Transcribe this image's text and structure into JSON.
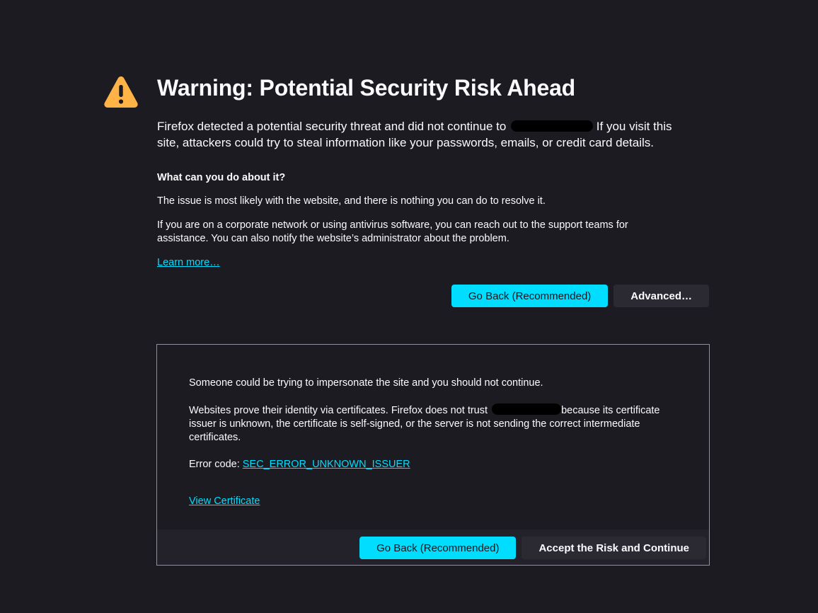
{
  "warning": {
    "icon": "warning-triangle-icon",
    "icon_color": "#ffb347",
    "title": "Warning: Potential Security Risk Ahead",
    "intro_before": "Firefox detected a potential security threat and did not continue to",
    "intro_after": "If you visit this site, attackers could try to steal information like your passwords, emails, or credit card details."
  },
  "help": {
    "heading": "What can you do about it?",
    "para1": "The issue is most likely with the website, and there is nothing you can do to resolve it.",
    "para2": "If you are on a corporate network or using antivirus software, you can reach out to the support teams for assistance. You can also notify the website’s administrator about the problem.",
    "learn_more": "Learn more…"
  },
  "actions": {
    "go_back": "Go Back (Recommended)",
    "advanced": "Advanced…"
  },
  "advanced_panel": {
    "para1": "Someone could be trying to impersonate the site and you should not continue.",
    "para2_before": "Websites prove their identity via certificates. Firefox does not trust",
    "para2_after": "because its certificate issuer is unknown, the certificate is self-signed, or the server is not sending the correct intermediate certificates.",
    "error_label": "Error code:",
    "error_code": "SEC_ERROR_UNKNOWN_ISSUER",
    "view_certificate": "View Certificate",
    "go_back": "Go Back (Recommended)",
    "accept": "Accept the Risk and Continue"
  },
  "colors": {
    "background": "#1c1b22",
    "accent": "#00ddff",
    "text": "#fbfbfe",
    "panel_border": "#8f8f9d"
  }
}
